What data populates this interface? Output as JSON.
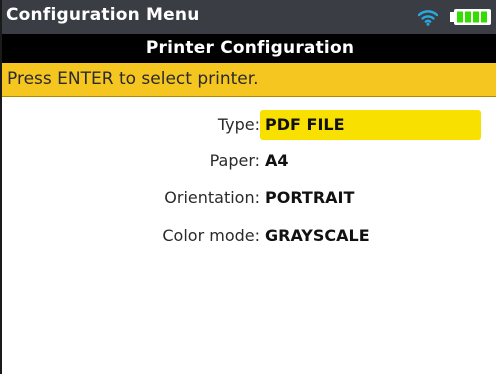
{
  "app": {
    "title": "Configuration Menu"
  },
  "status": {
    "wifi_icon": "wifi-icon",
    "battery_icon": "battery-full-icon",
    "battery_level": 1.0
  },
  "page": {
    "title": "Printer Configuration",
    "hint": "Press ENTER to select printer."
  },
  "settings": [
    {
      "label": "Type:",
      "value": "PDF FILE",
      "selected": true
    },
    {
      "label": "Paper:",
      "value": "A4",
      "selected": false
    },
    {
      "label": "Orientation:",
      "value": "PORTRAIT",
      "selected": false
    },
    {
      "label": "Color mode:",
      "value": "GRAYSCALE",
      "selected": false
    }
  ],
  "colors": {
    "status_bar": "#3a3d44",
    "title_bar": "#000000",
    "hint_bar": "#f5c520",
    "selection": "#f8e000",
    "wifi": "#29a8e0",
    "battery": "#33dd00"
  }
}
